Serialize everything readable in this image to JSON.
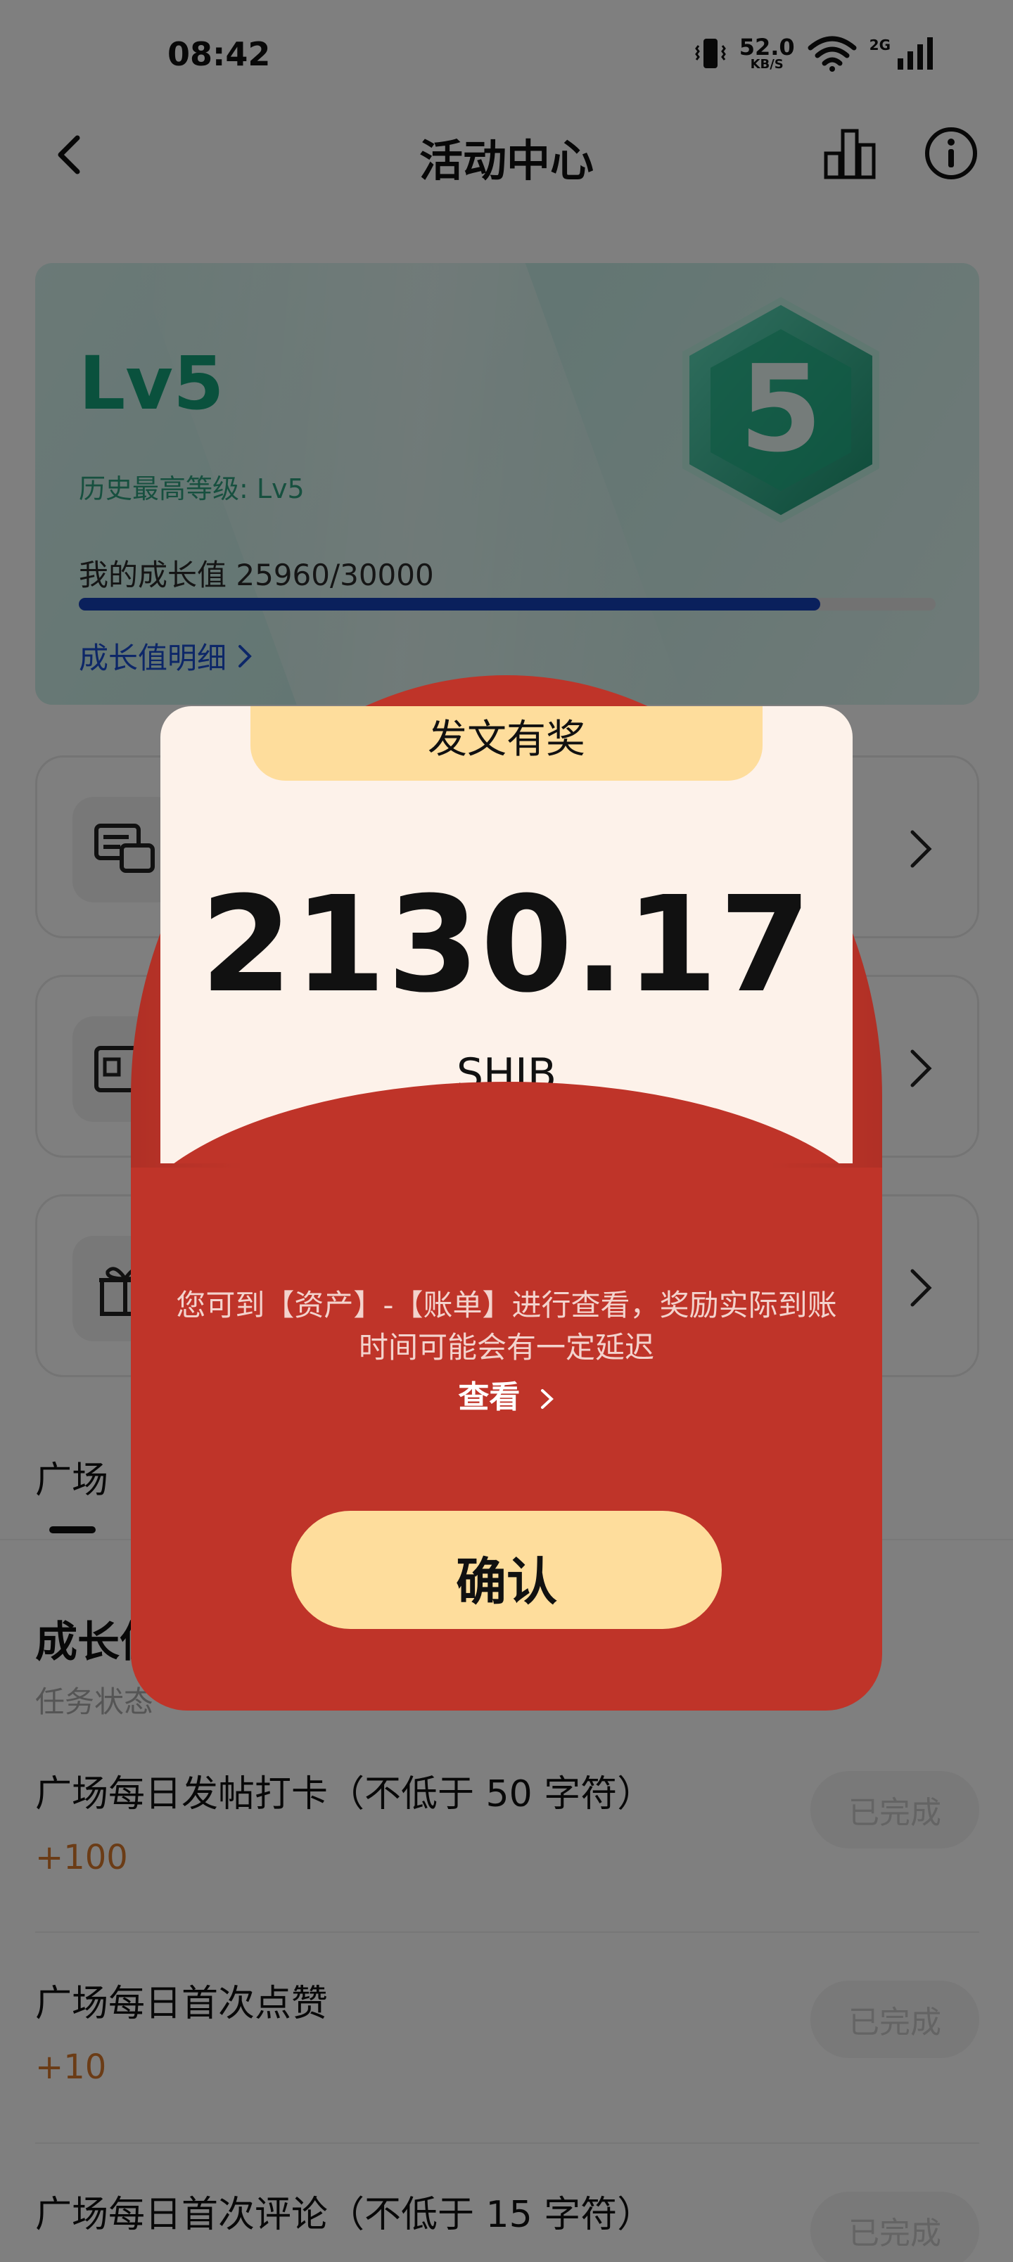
{
  "status_bar": {
    "time": "08:42",
    "speed_value": "52.0",
    "speed_unit": "KB/S",
    "network": "2G"
  },
  "nav": {
    "title": "活动中心",
    "back_icon": "chevron-left-icon",
    "stats_icon": "bar-chart-icon",
    "info_icon": "info-icon"
  },
  "level_card": {
    "level": "Lv5",
    "badge_number": "5",
    "history_highest": "历史最高等级: Lv5",
    "growth_label": "我的成长值 25960/30000",
    "growth_current": 25960,
    "growth_target": 30000,
    "detail_link": "成长值明细",
    "accent_color": "#14a37a",
    "progress_color": "#1440b8"
  },
  "square_tab": {
    "label": "广场"
  },
  "growth_tasks": {
    "title": "成长值",
    "subtitle": "任务状态",
    "items": [
      {
        "title": "广场每日发帖打卡（不低于 50 字符）",
        "points": "+100",
        "status": "已完成"
      },
      {
        "title": "广场每日首次点赞",
        "points": "+10",
        "status": "已完成"
      },
      {
        "title": "广场每日首次评论（不低于 15 字符）",
        "points": "",
        "status": "已完成"
      }
    ]
  },
  "reward_modal": {
    "title": "发文有奖",
    "amount": "2130.17",
    "currency": "SHIB",
    "notice": "您可到【资产】-【账单】进行查看，奖励实际到账时间可能会有一定延迟",
    "view_link": "查看",
    "confirm_label": "确认",
    "envelope_color": "#bf3429",
    "button_color": "#fedd9c"
  }
}
